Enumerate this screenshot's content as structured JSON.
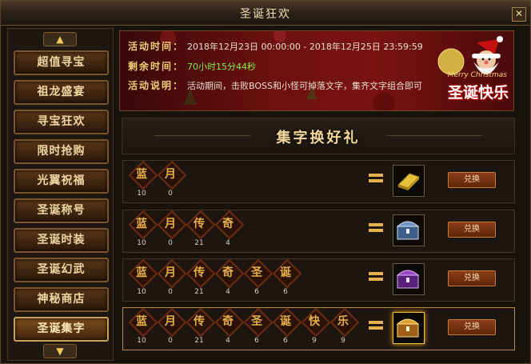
{
  "window": {
    "title": "圣诞狂欢",
    "close_label": "✕"
  },
  "nav": {
    "up_label": "▲",
    "down_label": "▼",
    "items": [
      {
        "label": "超值寻宝",
        "active": false
      },
      {
        "label": "祖龙盛宴",
        "active": false
      },
      {
        "label": "寻宝狂欢",
        "active": false
      },
      {
        "label": "限时抢购",
        "active": false
      },
      {
        "label": "光翼祝福",
        "active": false
      },
      {
        "label": "圣诞称号",
        "active": false
      },
      {
        "label": "圣诞时装",
        "active": false
      },
      {
        "label": "圣诞幻武",
        "active": false
      },
      {
        "label": "神秘商店",
        "active": false
      },
      {
        "label": "圣诞集字",
        "active": true
      }
    ]
  },
  "banner": {
    "time_label": "活动时间：",
    "time_value": "2018年12月23日 00:00:00 - 2018年12月25日 23:59:59",
    "remain_label": "剩余时间：",
    "remain_value": "70小时15分44秒",
    "desc_label": "活动说明：",
    "desc_value": "活动期间，击败BOSS和小怪可掉落文字，集齐文字组合即可兑换相应的奖励",
    "merry_text": "Merry Christmas",
    "greeting_text": "圣诞快乐"
  },
  "heading": "集字换好礼",
  "exchange_label": "兑换",
  "rows": [
    {
      "chars": [
        {
          "c": "蓝",
          "n": "10"
        },
        {
          "c": "月",
          "n": "0"
        }
      ],
      "reward_icon": "gold-bar-icon"
    },
    {
      "chars": [
        {
          "c": "蓝",
          "n": "10"
        },
        {
          "c": "月",
          "n": "0"
        },
        {
          "c": "传",
          "n": "21"
        },
        {
          "c": "奇",
          "n": "4"
        }
      ],
      "reward_icon": "silver-chest-icon"
    },
    {
      "chars": [
        {
          "c": "蓝",
          "n": "10"
        },
        {
          "c": "月",
          "n": "0"
        },
        {
          "c": "传",
          "n": "21"
        },
        {
          "c": "奇",
          "n": "4"
        },
        {
          "c": "圣",
          "n": "6"
        },
        {
          "c": "诞",
          "n": "6"
        }
      ],
      "reward_icon": "purple-chest-icon"
    },
    {
      "chars": [
        {
          "c": "蓝",
          "n": "10"
        },
        {
          "c": "月",
          "n": "0"
        },
        {
          "c": "传",
          "n": "21"
        },
        {
          "c": "奇",
          "n": "4"
        },
        {
          "c": "圣",
          "n": "6"
        },
        {
          "c": "诞",
          "n": "6"
        },
        {
          "c": "快",
          "n": "9"
        },
        {
          "c": "乐",
          "n": "9"
        }
      ],
      "reward_icon": "gold-chest-icon"
    }
  ],
  "colors": {
    "accent_gold": "#e8b04a",
    "green_text": "#7ef03e",
    "banner_red": "#7a1212"
  }
}
